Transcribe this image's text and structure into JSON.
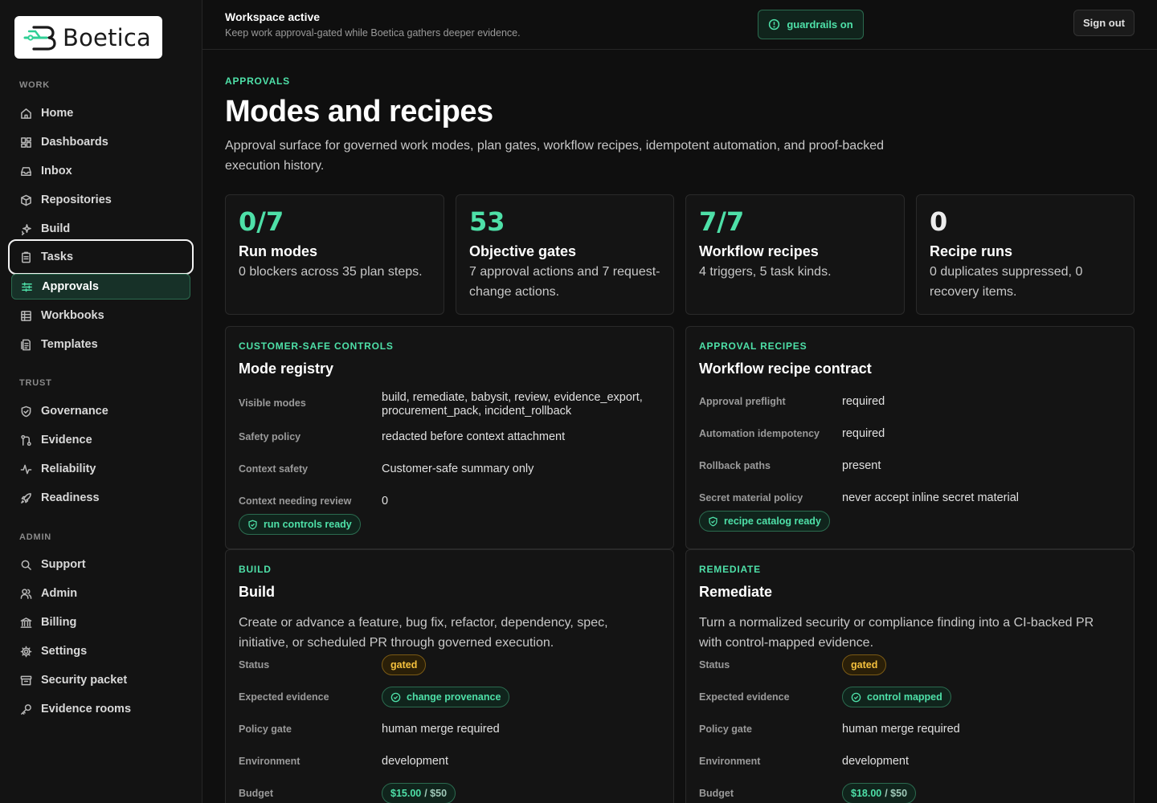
{
  "brand": {
    "name": "Boetica"
  },
  "sidebar": {
    "sections": [
      {
        "label": "WORK"
      },
      {
        "label": "TRUST"
      },
      {
        "label": "ADMIN"
      }
    ],
    "items": [
      {
        "label": "Home",
        "icon": "home-icon"
      },
      {
        "label": "Dashboards",
        "icon": "dashboard-grid-icon"
      },
      {
        "label": "Inbox",
        "icon": "inbox-icon"
      },
      {
        "label": "Repositories",
        "icon": "package-icon"
      },
      {
        "label": "Build",
        "icon": "sparkle-icon"
      },
      {
        "label": "Tasks",
        "icon": "clipboard-icon"
      },
      {
        "label": "Approvals",
        "icon": "sliders-icon"
      },
      {
        "label": "Workbooks",
        "icon": "table-icon"
      },
      {
        "label": "Templates",
        "icon": "document-icon"
      },
      {
        "label": "Governance",
        "icon": "shield-check-icon"
      },
      {
        "label": "Evidence",
        "icon": "git-compare-icon"
      },
      {
        "label": "Reliability",
        "icon": "activity-icon"
      },
      {
        "label": "Readiness",
        "icon": "rocket-icon"
      },
      {
        "label": "Support",
        "icon": "search-icon"
      },
      {
        "label": "Admin",
        "icon": "users-icon"
      },
      {
        "label": "Billing",
        "icon": "bank-icon"
      },
      {
        "label": "Settings",
        "icon": "gear-icon"
      },
      {
        "label": "Security packet",
        "icon": "archive-icon"
      },
      {
        "label": "Evidence rooms",
        "icon": "key-icon"
      }
    ]
  },
  "header": {
    "title": "Workspace active",
    "subtitle": "Keep work approval-gated while Boetica gathers deeper evidence.",
    "guardrails_label": "guardrails on",
    "signout_label": "Sign out"
  },
  "page": {
    "eyebrow": "APPROVALS",
    "title": "Modes and recipes",
    "description": "Approval surface for governed work modes, plan gates, workflow recipes, idempotent automation, and proof-backed execution history."
  },
  "stats": [
    {
      "value": "0/7",
      "title": "Run modes",
      "desc": "0 blockers across 35 plan steps."
    },
    {
      "value": "53",
      "title": "Objective gates",
      "desc": "7 approval actions and 7 request-change actions."
    },
    {
      "value": "7/7",
      "title": "Workflow recipes",
      "desc": "4 triggers, 5 task kinds."
    },
    {
      "value": "0",
      "title": "Recipe runs",
      "desc": "0 duplicates suppressed, 0 recovery items."
    }
  ],
  "mode_registry": {
    "eyebrow": "CUSTOMER-SAFE CONTROLS",
    "title": "Mode registry",
    "rows": [
      {
        "label": "Visible modes",
        "value": "build, remediate, babysit, review, evidence_export, procurement_pack, incident_rollback"
      },
      {
        "label": "Safety policy",
        "value": "redacted before context attachment"
      },
      {
        "label": "Context safety",
        "value": "Customer-safe summary only"
      },
      {
        "label": "Context needing review",
        "value": "0"
      }
    ],
    "badge": "run controls ready"
  },
  "recipe_contract": {
    "eyebrow": "APPROVAL RECIPES",
    "title": "Workflow recipe contract",
    "rows": [
      {
        "label": "Approval preflight",
        "value": "required"
      },
      {
        "label": "Automation idempotency",
        "value": "required"
      },
      {
        "label": "Rollback paths",
        "value": "present"
      },
      {
        "label": "Secret material policy",
        "value": "never accept inline secret material"
      }
    ],
    "badge": "recipe catalog ready"
  },
  "modes": [
    {
      "eyebrow": "BUILD",
      "title": "Build",
      "description": "Create or advance a feature, bug fix, refactor, dependency, spec, initiative, or scheduled PR through governed execution.",
      "labels": {
        "status": "Status",
        "evidence": "Expected evidence",
        "policy": "Policy gate",
        "env": "Environment",
        "budget": "Budget"
      },
      "status": "gated",
      "evidence": "change provenance",
      "policy": "human merge required",
      "environment": "development",
      "budget_spent": "$15.00",
      "budget_limit": "/ $50"
    },
    {
      "eyebrow": "REMEDIATE",
      "title": "Remediate",
      "description": "Turn a normalized security or compliance finding into a CI-backed PR with control-mapped evidence.",
      "labels": {
        "status": "Status",
        "evidence": "Expected evidence",
        "policy": "Policy gate",
        "env": "Environment",
        "budget": "Budget"
      },
      "status": "gated",
      "evidence": "control mapped",
      "policy": "human merge required",
      "environment": "development",
      "budget_spent": "$18.00",
      "budget_limit": "/ $50"
    }
  ],
  "colors": {
    "accent": "#4ee0a8",
    "amber": "#f5c13d",
    "background": "#0f0f0f"
  }
}
